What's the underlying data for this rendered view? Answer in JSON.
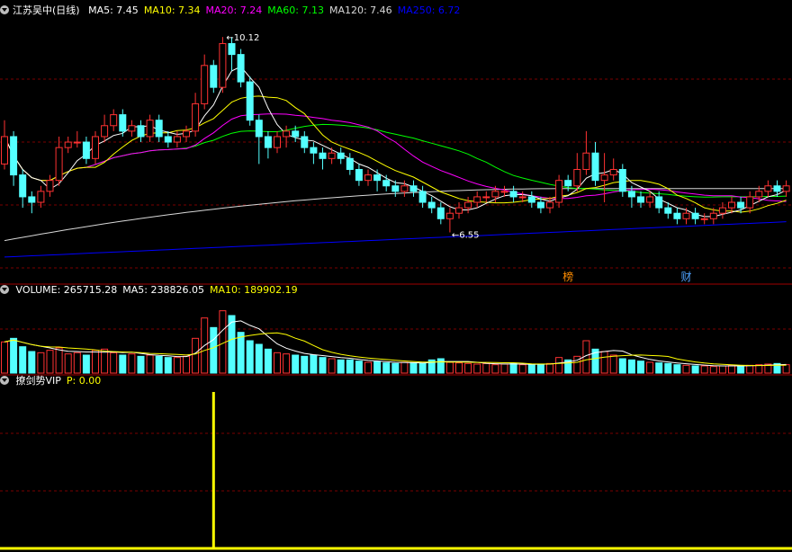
{
  "panels": {
    "main": {
      "stock_name": "江苏吴中(日线)",
      "indicators": [
        {
          "label": "MA5: 7.45",
          "color": "#ffffff"
        },
        {
          "label": "MA10: 7.34",
          "color": "#ffff00"
        },
        {
          "label": "MA20: 7.24",
          "color": "#ff00ff"
        },
        {
          "label": "MA60: 7.13",
          "color": "#00ff00"
        },
        {
          "label": "MA120: 7.46",
          "color": "#d8d8d8"
        },
        {
          "label": "MA250: 6.72",
          "color": "#0000ff"
        }
      ],
      "high_label": "10.12",
      "low_label": "6.55",
      "markers": [
        "榜",
        "财"
      ]
    },
    "volume": {
      "indicators": [
        {
          "label": "VOLUME: 265715.28",
          "color": "#ffffff"
        },
        {
          "label": "MA5: 238826.05",
          "color": "#ffffff"
        },
        {
          "label": "MA10: 189902.19",
          "color": "#ffff00"
        }
      ]
    },
    "sub": {
      "indicators": [
        {
          "label": "撩剑势VIP",
          "color": "#ffffff"
        },
        {
          "label": "P: 0.00",
          "color": "#ffff00"
        }
      ]
    }
  },
  "colors": {
    "up": "#ff3232",
    "down": "#54ffff",
    "grid": "#7a0000",
    "ma5": "#ffffff",
    "ma10": "#ffff00",
    "ma20": "#ff00ff",
    "ma60": "#00ff00",
    "ma120": "#d8d8d8",
    "ma250": "#0000ff",
    "signal": "#ffff00"
  },
  "chart_data": {
    "type": "candlestick",
    "price_ylim": [
      6.0,
      10.5
    ],
    "volume_ylim": [
      0,
      600000
    ],
    "candles": [
      [
        7.8,
        8.3,
        8.6,
        7.7
      ],
      [
        8.3,
        7.6,
        8.4,
        7.4
      ],
      [
        7.6,
        7.2,
        7.7,
        7.0
      ],
      [
        7.2,
        7.1,
        7.3,
        6.9
      ],
      [
        7.1,
        7.3,
        7.4,
        7.0
      ],
      [
        7.3,
        7.5,
        7.6,
        7.2
      ],
      [
        7.5,
        8.1,
        8.3,
        7.4
      ],
      [
        8.1,
        8.2,
        8.3,
        8.0
      ],
      [
        8.2,
        8.2,
        8.4,
        8.1
      ],
      [
        8.2,
        7.9,
        8.3,
        7.8
      ],
      [
        7.9,
        8.3,
        8.4,
        7.8
      ],
      [
        8.3,
        8.5,
        8.7,
        8.2
      ],
      [
        8.5,
        8.7,
        8.8,
        8.4
      ],
      [
        8.7,
        8.4,
        8.8,
        8.3
      ],
      [
        8.4,
        8.5,
        8.6,
        8.3
      ],
      [
        8.5,
        8.3,
        8.6,
        8.2
      ],
      [
        8.3,
        8.6,
        8.7,
        8.2
      ],
      [
        8.6,
        8.3,
        8.7,
        8.2
      ],
      [
        8.3,
        8.2,
        8.4,
        8.1
      ],
      [
        8.2,
        8.3,
        8.4,
        8.1
      ],
      [
        8.3,
        8.4,
        8.5,
        8.2
      ],
      [
        8.4,
        8.9,
        9.1,
        8.3
      ],
      [
        8.9,
        9.6,
        9.8,
        8.8
      ],
      [
        9.6,
        9.2,
        9.7,
        9.1
      ],
      [
        9.2,
        10.0,
        10.12,
        9.1
      ],
      [
        10.0,
        9.8,
        10.12,
        9.5
      ],
      [
        9.8,
        9.3,
        9.9,
        9.2
      ],
      [
        9.3,
        8.6,
        9.4,
        8.5
      ],
      [
        8.6,
        8.3,
        8.7,
        7.8
      ],
      [
        8.3,
        8.1,
        8.4,
        7.9
      ],
      [
        8.1,
        8.3,
        8.4,
        8.0
      ],
      [
        8.3,
        8.4,
        8.5,
        8.1
      ],
      [
        8.4,
        8.3,
        8.5,
        8.2
      ],
      [
        8.3,
        8.1,
        8.4,
        8.0
      ],
      [
        8.1,
        8.0,
        8.2,
        7.8
      ],
      [
        8.0,
        7.9,
        8.1,
        7.7
      ],
      [
        7.9,
        8.0,
        8.1,
        7.8
      ],
      [
        8.0,
        7.9,
        8.1,
        7.8
      ],
      [
        7.9,
        7.7,
        8.0,
        7.6
      ],
      [
        7.7,
        7.5,
        7.8,
        7.4
      ],
      [
        7.5,
        7.6,
        7.7,
        7.4
      ],
      [
        7.6,
        7.5,
        7.7,
        7.3
      ],
      [
        7.5,
        7.4,
        7.6,
        7.3
      ],
      [
        7.4,
        7.3,
        7.5,
        7.2
      ],
      [
        7.3,
        7.4,
        7.5,
        7.2
      ],
      [
        7.4,
        7.3,
        7.5,
        7.2
      ],
      [
        7.3,
        7.1,
        7.4,
        7.0
      ],
      [
        7.1,
        7.0,
        7.2,
        6.9
      ],
      [
        7.0,
        6.8,
        7.1,
        6.7
      ],
      [
        6.8,
        6.9,
        7.0,
        6.55
      ],
      [
        6.9,
        7.0,
        7.1,
        6.8
      ],
      [
        7.0,
        7.1,
        7.2,
        6.9
      ],
      [
        7.1,
        7.2,
        7.3,
        7.0
      ],
      [
        7.2,
        7.2,
        7.3,
        7.1
      ],
      [
        7.2,
        7.3,
        7.4,
        7.1
      ],
      [
        7.3,
        7.3,
        7.4,
        7.2
      ],
      [
        7.3,
        7.2,
        7.4,
        7.1
      ],
      [
        7.2,
        7.2,
        7.3,
        7.1
      ],
      [
        7.2,
        7.1,
        7.3,
        7.0
      ],
      [
        7.1,
        7.0,
        7.2,
        6.9
      ],
      [
        7.0,
        7.1,
        7.2,
        6.9
      ],
      [
        7.1,
        7.5,
        7.6,
        7.0
      ],
      [
        7.5,
        7.4,
        7.6,
        7.3
      ],
      [
        7.4,
        7.7,
        8.0,
        7.3
      ],
      [
        7.7,
        8.0,
        8.4,
        7.6
      ],
      [
        8.0,
        7.5,
        8.2,
        7.4
      ],
      [
        7.5,
        7.6,
        8.0,
        7.1
      ],
      [
        7.6,
        7.7,
        7.9,
        7.5
      ],
      [
        7.7,
        7.3,
        7.8,
        7.2
      ],
      [
        7.3,
        7.2,
        7.4,
        7.0
      ],
      [
        7.2,
        7.1,
        7.3,
        7.0
      ],
      [
        7.1,
        7.2,
        7.3,
        7.0
      ],
      [
        7.2,
        7.0,
        7.3,
        6.9
      ],
      [
        7.0,
        6.9,
        7.1,
        6.8
      ],
      [
        6.9,
        6.8,
        7.0,
        6.7
      ],
      [
        6.8,
        6.9,
        7.0,
        6.7
      ],
      [
        6.9,
        6.8,
        7.0,
        6.7
      ],
      [
        6.8,
        6.8,
        6.9,
        6.7
      ],
      [
        6.8,
        6.9,
        7.0,
        6.7
      ],
      [
        6.9,
        7.0,
        7.1,
        6.8
      ],
      [
        7.0,
        7.1,
        7.2,
        6.9
      ],
      [
        7.1,
        7.0,
        7.2,
        6.9
      ],
      [
        7.0,
        7.2,
        7.3,
        6.9
      ],
      [
        7.2,
        7.3,
        7.4,
        7.1
      ],
      [
        7.3,
        7.4,
        7.5,
        7.2
      ],
      [
        7.4,
        7.3,
        7.5,
        7.2
      ],
      [
        7.3,
        7.4,
        7.5,
        7.2
      ]
    ],
    "volumes": [
      260000,
      290000,
      220000,
      180000,
      170000,
      190000,
      210000,
      160000,
      170000,
      150000,
      190000,
      200000,
      170000,
      150000,
      160000,
      140000,
      150000,
      140000,
      130000,
      130000,
      140000,
      290000,
      460000,
      380000,
      520000,
      480000,
      340000,
      270000,
      240000,
      200000,
      170000,
      160000,
      150000,
      140000,
      150000,
      130000,
      120000,
      110000,
      110000,
      100000,
      90000,
      95000,
      85000,
      80000,
      90000,
      85000,
      80000,
      110000,
      120000,
      90000,
      85000,
      80000,
      75000,
      80000,
      70000,
      75000,
      80000,
      70000,
      70000,
      75000,
      80000,
      130000,
      110000,
      140000,
      270000,
      200000,
      180000,
      150000,
      120000,
      110000,
      100000,
      90000,
      85000,
      80000,
      70000,
      65000,
      60000,
      60000,
      55000,
      60000,
      65000,
      60000,
      65000,
      70000,
      75000,
      80000,
      70000
    ],
    "signals": [
      {
        "index": 23,
        "value": 1
      }
    ]
  }
}
